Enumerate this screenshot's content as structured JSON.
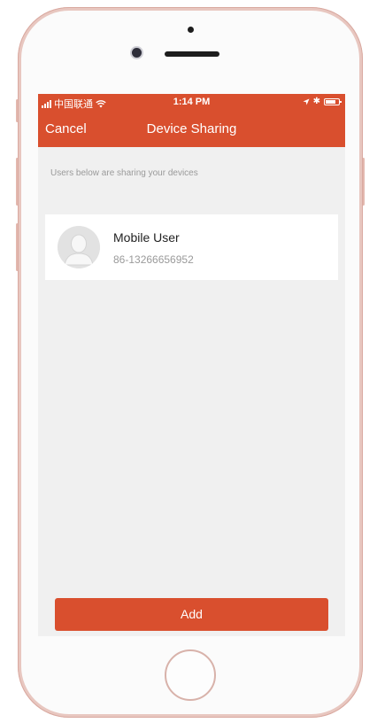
{
  "status_bar": {
    "carrier": "中国联通",
    "time": "1:14 PM",
    "bluetooth": "✱"
  },
  "nav": {
    "cancel_label": "Cancel",
    "title": "Device Sharing"
  },
  "content": {
    "hint": "Users below are sharing your devices",
    "users": [
      {
        "name": "Mobile User",
        "phone": "86-13266656952"
      }
    ]
  },
  "footer": {
    "add_label": "Add"
  },
  "colors": {
    "accent": "#d94f2e",
    "background": "#f0f0f0"
  }
}
